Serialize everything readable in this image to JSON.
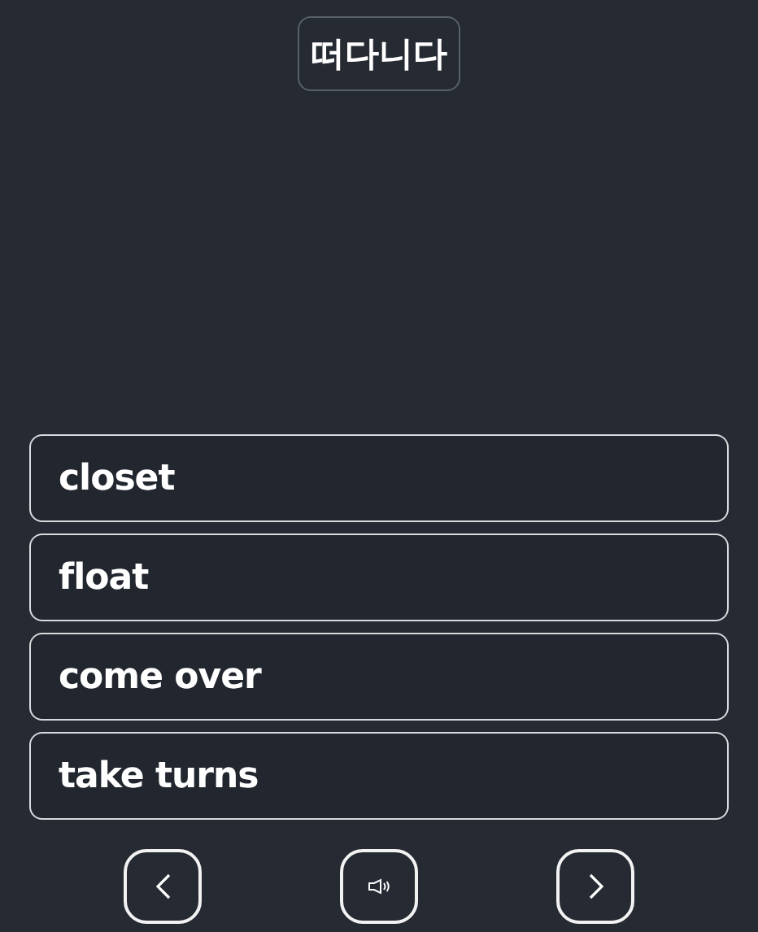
{
  "word": "떠다니다",
  "options": [
    {
      "label": "closet"
    },
    {
      "label": "float"
    },
    {
      "label": "come over"
    },
    {
      "label": "take turns"
    }
  ],
  "nav": [
    {
      "kind": "previous"
    },
    {
      "kind": "audio"
    },
    {
      "kind": "next"
    }
  ]
}
